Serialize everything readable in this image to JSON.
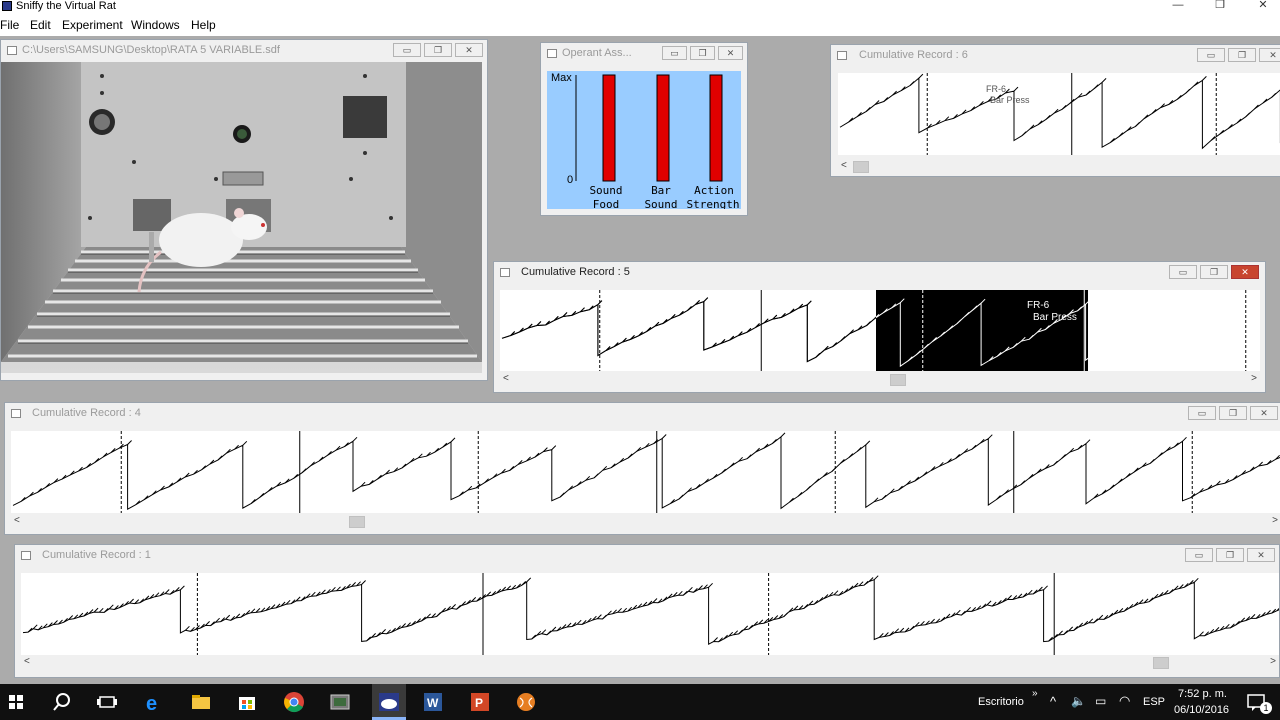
{
  "app": {
    "title": "Sniffy the Virtual Rat"
  },
  "window_controls": {
    "minimize": "—",
    "maximize": "❐",
    "close": "✕"
  },
  "menu": [
    {
      "label": "File"
    },
    {
      "label": "Edit"
    },
    {
      "label": "Experiment"
    },
    {
      "label": "Windows"
    },
    {
      "label": "Help"
    }
  ],
  "chamber": {
    "title": "C:\\Users\\SAMSUNG\\Desktop\\RATA 5 VARIABLE.sdf"
  },
  "operant": {
    "title": "Operant Ass...",
    "y_top": "Max",
    "y_bottom": "0",
    "bar_color": "#e00000",
    "bars": [
      {
        "line1": "Sound",
        "line2": "Food",
        "value": 1.0
      },
      {
        "line1": "Bar",
        "line2": "Sound",
        "value": 1.0
      },
      {
        "line1": "Action",
        "line2": "Strength",
        "value": 1.0
      }
    ]
  },
  "cumulative_records": [
    {
      "id": "cr6",
      "title": "Cumulative Record : 6",
      "label1": "FR-6",
      "label2": "Bar Press"
    },
    {
      "id": "cr5",
      "title": "Cumulative Record : 5",
      "label1": "FR-6",
      "label2": "Bar Press"
    },
    {
      "id": "cr4",
      "title": "Cumulative Record : 4"
    },
    {
      "id": "cr1",
      "title": "Cumulative Record : 1"
    }
  ],
  "taskbar": {
    "desktop_label": "Escritorio",
    "language": "ESP",
    "time": "7:52 p. m.",
    "date": "06/10/2016",
    "notification_count": "1",
    "apps": [
      {
        "name": "start-icon"
      },
      {
        "name": "search-icon"
      },
      {
        "name": "task-view-icon"
      },
      {
        "name": "edge-icon"
      },
      {
        "name": "file-explorer-icon"
      },
      {
        "name": "store-icon"
      },
      {
        "name": "chrome-icon"
      },
      {
        "name": "media-icon"
      },
      {
        "name": "sniffy-icon"
      },
      {
        "name": "word-icon"
      },
      {
        "name": "powerpoint-icon"
      },
      {
        "name": "baseball-icon"
      }
    ]
  }
}
